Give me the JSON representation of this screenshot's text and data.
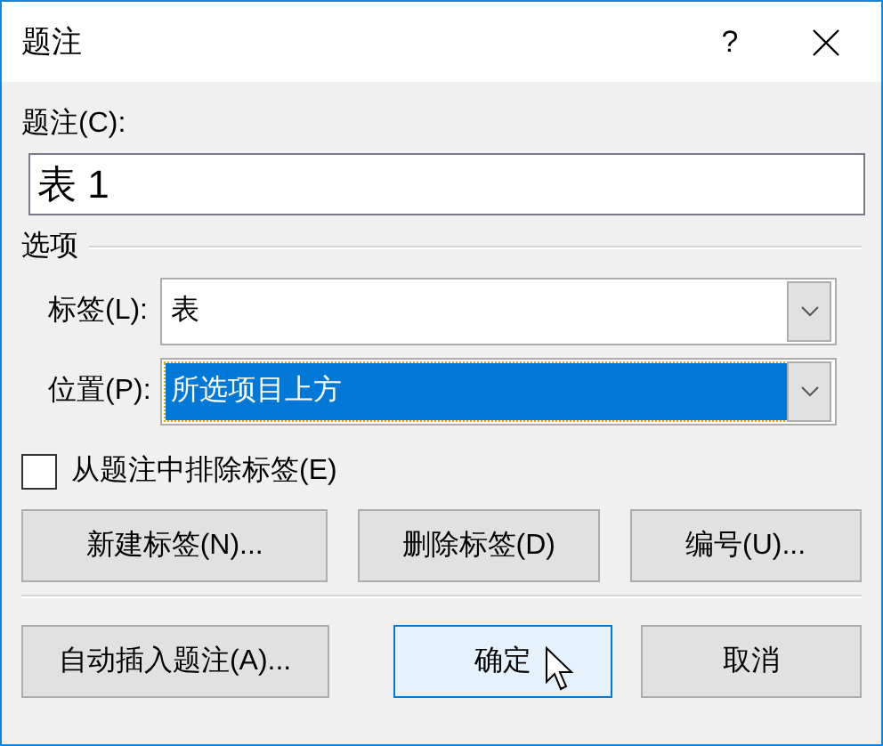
{
  "window": {
    "title": "题注",
    "help": "?"
  },
  "caption": {
    "label": "题注(C):",
    "value": "表 1"
  },
  "options": {
    "title": "选项",
    "fields": [
      {
        "label": "标签(L):",
        "value": "表",
        "highlighted": false
      },
      {
        "label": "位置(P):",
        "value": "所选项目上方",
        "highlighted": true
      }
    ]
  },
  "exclude_label": {
    "label": "从题注中排除标签(E)",
    "checked": false
  },
  "label_buttons": [
    {
      "label": "新建标签(N)...",
      "focused": false
    },
    {
      "label": "删除标签(D)",
      "focused": false
    },
    {
      "label": "编号(U)...",
      "focused": false
    }
  ],
  "dialog_buttons": [
    {
      "label": "自动插入题注(A)...",
      "focused": false
    },
    {
      "label": "确定",
      "focused": true
    },
    {
      "label": "取消",
      "focused": false
    }
  ]
}
